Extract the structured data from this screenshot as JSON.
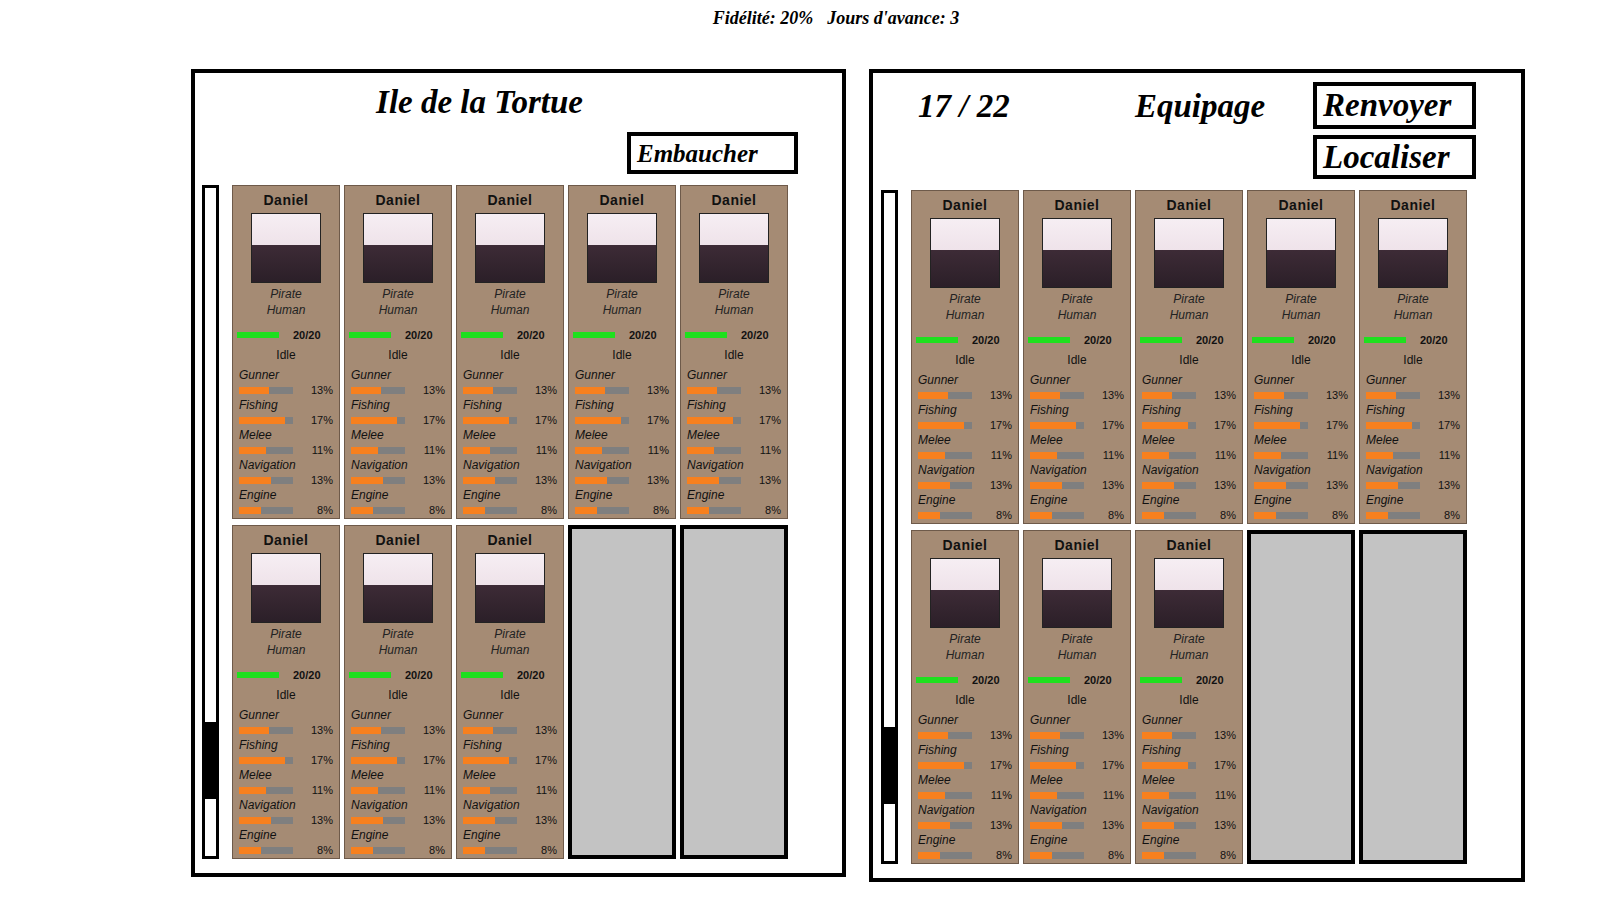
{
  "status": {
    "fidelity": "Fidélité: 20%",
    "days": "Jours d'avance: 3"
  },
  "recruit_panel": {
    "title": "Ile de la Tortue",
    "button": "Embaucher",
    "scroll": {
      "position": 0.8,
      "size": 0.115
    },
    "slots": [
      {
        "kind": "crew",
        "name": "Daniel",
        "class": "Pirate",
        "race": "Human",
        "hp": "20/20",
        "hp_level": 1,
        "status": "Idle",
        "skills": [
          {
            "name": "Gunner",
            "reading": "13%",
            "level": 0.55
          },
          {
            "name": "Fishing",
            "reading": "17%",
            "level": 0.85
          },
          {
            "name": "Melee",
            "reading": "11%",
            "level": 0.5
          },
          {
            "name": "Navigation",
            "reading": "13%",
            "level": 0.6
          },
          {
            "name": "Engine",
            "reading": "8%",
            "level": 0.4
          }
        ]
      },
      {
        "kind": "crew",
        "name": "Daniel",
        "class": "Pirate",
        "race": "Human",
        "hp": "20/20",
        "hp_level": 1,
        "status": "Idle",
        "skills": [
          {
            "name": "Gunner",
            "reading": "13%",
            "level": 0.55
          },
          {
            "name": "Fishing",
            "reading": "17%",
            "level": 0.85
          },
          {
            "name": "Melee",
            "reading": "11%",
            "level": 0.5
          },
          {
            "name": "Navigation",
            "reading": "13%",
            "level": 0.6
          },
          {
            "name": "Engine",
            "reading": "8%",
            "level": 0.4
          }
        ]
      },
      {
        "kind": "crew",
        "name": "Daniel",
        "class": "Pirate",
        "race": "Human",
        "hp": "20/20",
        "hp_level": 1,
        "status": "Idle",
        "skills": [
          {
            "name": "Gunner",
            "reading": "13%",
            "level": 0.55
          },
          {
            "name": "Fishing",
            "reading": "17%",
            "level": 0.85
          },
          {
            "name": "Melee",
            "reading": "11%",
            "level": 0.5
          },
          {
            "name": "Navigation",
            "reading": "13%",
            "level": 0.6
          },
          {
            "name": "Engine",
            "reading": "8%",
            "level": 0.4
          }
        ]
      },
      {
        "kind": "crew",
        "name": "Daniel",
        "class": "Pirate",
        "race": "Human",
        "hp": "20/20",
        "hp_level": 1,
        "status": "Idle",
        "skills": [
          {
            "name": "Gunner",
            "reading": "13%",
            "level": 0.55
          },
          {
            "name": "Fishing",
            "reading": "17%",
            "level": 0.85
          },
          {
            "name": "Melee",
            "reading": "11%",
            "level": 0.5
          },
          {
            "name": "Navigation",
            "reading": "13%",
            "level": 0.6
          },
          {
            "name": "Engine",
            "reading": "8%",
            "level": 0.4
          }
        ]
      },
      {
        "kind": "crew",
        "name": "Daniel",
        "class": "Pirate",
        "race": "Human",
        "hp": "20/20",
        "hp_level": 1,
        "status": "Idle",
        "skills": [
          {
            "name": "Gunner",
            "reading": "13%",
            "level": 0.55
          },
          {
            "name": "Fishing",
            "reading": "17%",
            "level": 0.85
          },
          {
            "name": "Melee",
            "reading": "11%",
            "level": 0.5
          },
          {
            "name": "Navigation",
            "reading": "13%",
            "level": 0.6
          },
          {
            "name": "Engine",
            "reading": "8%",
            "level": 0.4
          }
        ]
      },
      {
        "kind": "crew",
        "name": "Daniel",
        "class": "Pirate",
        "race": "Human",
        "hp": "20/20",
        "hp_level": 1,
        "status": "Idle",
        "skills": [
          {
            "name": "Gunner",
            "reading": "13%",
            "level": 0.55
          },
          {
            "name": "Fishing",
            "reading": "17%",
            "level": 0.85
          },
          {
            "name": "Melee",
            "reading": "11%",
            "level": 0.5
          },
          {
            "name": "Navigation",
            "reading": "13%",
            "level": 0.6
          },
          {
            "name": "Engine",
            "reading": "8%",
            "level": 0.4
          }
        ]
      },
      {
        "kind": "crew",
        "name": "Daniel",
        "class": "Pirate",
        "race": "Human",
        "hp": "20/20",
        "hp_level": 1,
        "status": "Idle",
        "skills": [
          {
            "name": "Gunner",
            "reading": "13%",
            "level": 0.55
          },
          {
            "name": "Fishing",
            "reading": "17%",
            "level": 0.85
          },
          {
            "name": "Melee",
            "reading": "11%",
            "level": 0.5
          },
          {
            "name": "Navigation",
            "reading": "13%",
            "level": 0.6
          },
          {
            "name": "Engine",
            "reading": "8%",
            "level": 0.4
          }
        ]
      },
      {
        "kind": "crew",
        "name": "Daniel",
        "class": "Pirate",
        "race": "Human",
        "hp": "20/20",
        "hp_level": 1,
        "status": "Idle",
        "skills": [
          {
            "name": "Gunner",
            "reading": "13%",
            "level": 0.55
          },
          {
            "name": "Fishing",
            "reading": "17%",
            "level": 0.85
          },
          {
            "name": "Melee",
            "reading": "11%",
            "level": 0.5
          },
          {
            "name": "Navigation",
            "reading": "13%",
            "level": 0.6
          },
          {
            "name": "Engine",
            "reading": "8%",
            "level": 0.4
          }
        ]
      },
      {
        "kind": "empty"
      },
      {
        "kind": "empty"
      }
    ]
  },
  "crew_panel": {
    "count": "17 / 22",
    "title": "Equipage",
    "buttons": [
      "Renvoyer",
      "Localiser"
    ],
    "scroll": {
      "position": 0.8,
      "size": 0.115
    },
    "slots": [
      {
        "kind": "crew",
        "name": "Daniel",
        "class": "Pirate",
        "race": "Human",
        "hp": "20/20",
        "hp_level": 1,
        "status": "Idle",
        "skills": [
          {
            "name": "Gunner",
            "reading": "13%",
            "level": 0.55
          },
          {
            "name": "Fishing",
            "reading": "17%",
            "level": 0.85
          },
          {
            "name": "Melee",
            "reading": "11%",
            "level": 0.5
          },
          {
            "name": "Navigation",
            "reading": "13%",
            "level": 0.6
          },
          {
            "name": "Engine",
            "reading": "8%",
            "level": 0.4
          }
        ]
      },
      {
        "kind": "crew",
        "name": "Daniel",
        "class": "Pirate",
        "race": "Human",
        "hp": "20/20",
        "hp_level": 1,
        "status": "Idle",
        "skills": [
          {
            "name": "Gunner",
            "reading": "13%",
            "level": 0.55
          },
          {
            "name": "Fishing",
            "reading": "17%",
            "level": 0.85
          },
          {
            "name": "Melee",
            "reading": "11%",
            "level": 0.5
          },
          {
            "name": "Navigation",
            "reading": "13%",
            "level": 0.6
          },
          {
            "name": "Engine",
            "reading": "8%",
            "level": 0.4
          }
        ]
      },
      {
        "kind": "crew",
        "name": "Daniel",
        "class": "Pirate",
        "race": "Human",
        "hp": "20/20",
        "hp_level": 1,
        "status": "Idle",
        "skills": [
          {
            "name": "Gunner",
            "reading": "13%",
            "level": 0.55
          },
          {
            "name": "Fishing",
            "reading": "17%",
            "level": 0.85
          },
          {
            "name": "Melee",
            "reading": "11%",
            "level": 0.5
          },
          {
            "name": "Navigation",
            "reading": "13%",
            "level": 0.6
          },
          {
            "name": "Engine",
            "reading": "8%",
            "level": 0.4
          }
        ]
      },
      {
        "kind": "crew",
        "name": "Daniel",
        "class": "Pirate",
        "race": "Human",
        "hp": "20/20",
        "hp_level": 1,
        "status": "Idle",
        "skills": [
          {
            "name": "Gunner",
            "reading": "13%",
            "level": 0.55
          },
          {
            "name": "Fishing",
            "reading": "17%",
            "level": 0.85
          },
          {
            "name": "Melee",
            "reading": "11%",
            "level": 0.5
          },
          {
            "name": "Navigation",
            "reading": "13%",
            "level": 0.6
          },
          {
            "name": "Engine",
            "reading": "8%",
            "level": 0.4
          }
        ]
      },
      {
        "kind": "crew",
        "name": "Daniel",
        "class": "Pirate",
        "race": "Human",
        "hp": "20/20",
        "hp_level": 1,
        "status": "Idle",
        "skills": [
          {
            "name": "Gunner",
            "reading": "13%",
            "level": 0.55
          },
          {
            "name": "Fishing",
            "reading": "17%",
            "level": 0.85
          },
          {
            "name": "Melee",
            "reading": "11%",
            "level": 0.5
          },
          {
            "name": "Navigation",
            "reading": "13%",
            "level": 0.6
          },
          {
            "name": "Engine",
            "reading": "8%",
            "level": 0.4
          }
        ]
      },
      {
        "kind": "crew",
        "name": "Daniel",
        "class": "Pirate",
        "race": "Human",
        "hp": "20/20",
        "hp_level": 1,
        "status": "Idle",
        "skills": [
          {
            "name": "Gunner",
            "reading": "13%",
            "level": 0.55
          },
          {
            "name": "Fishing",
            "reading": "17%",
            "level": 0.85
          },
          {
            "name": "Melee",
            "reading": "11%",
            "level": 0.5
          },
          {
            "name": "Navigation",
            "reading": "13%",
            "level": 0.6
          },
          {
            "name": "Engine",
            "reading": "8%",
            "level": 0.4
          }
        ]
      },
      {
        "kind": "crew",
        "name": "Daniel",
        "class": "Pirate",
        "race": "Human",
        "hp": "20/20",
        "hp_level": 1,
        "status": "Idle",
        "skills": [
          {
            "name": "Gunner",
            "reading": "13%",
            "level": 0.55
          },
          {
            "name": "Fishing",
            "reading": "17%",
            "level": 0.85
          },
          {
            "name": "Melee",
            "reading": "11%",
            "level": 0.5
          },
          {
            "name": "Navigation",
            "reading": "13%",
            "level": 0.6
          },
          {
            "name": "Engine",
            "reading": "8%",
            "level": 0.4
          }
        ]
      },
      {
        "kind": "crew",
        "name": "Daniel",
        "class": "Pirate",
        "race": "Human",
        "hp": "20/20",
        "hp_level": 1,
        "status": "Idle",
        "skills": [
          {
            "name": "Gunner",
            "reading": "13%",
            "level": 0.55
          },
          {
            "name": "Fishing",
            "reading": "17%",
            "level": 0.85
          },
          {
            "name": "Melee",
            "reading": "11%",
            "level": 0.5
          },
          {
            "name": "Navigation",
            "reading": "13%",
            "level": 0.6
          },
          {
            "name": "Engine",
            "reading": "8%",
            "level": 0.4
          }
        ]
      },
      {
        "kind": "empty"
      },
      {
        "kind": "empty"
      }
    ]
  }
}
